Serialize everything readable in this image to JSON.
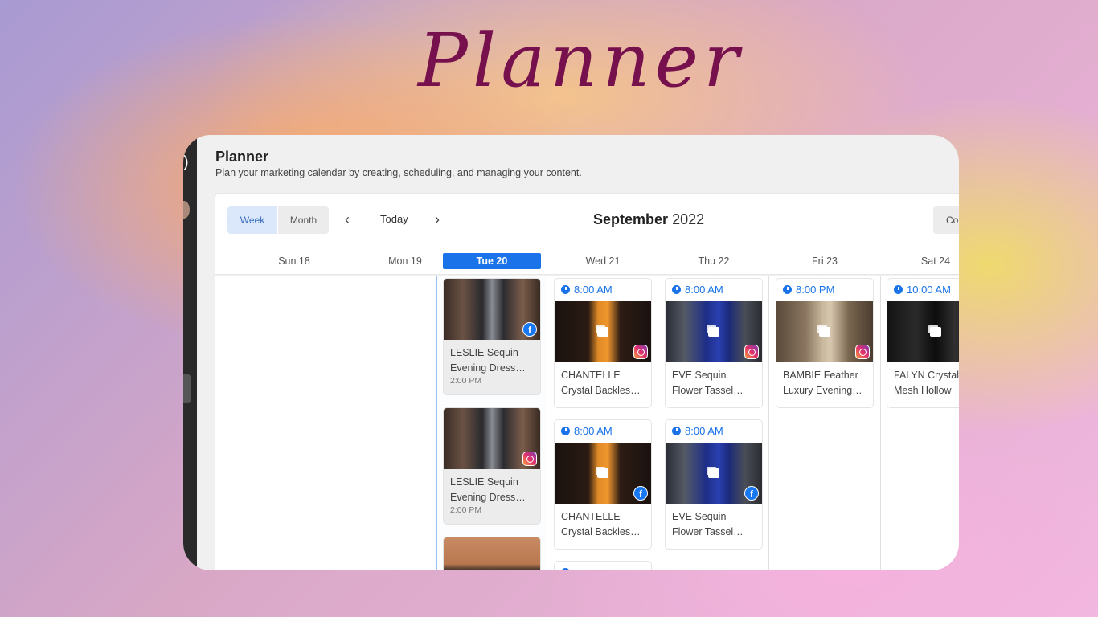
{
  "hero": {
    "title": "Planner"
  },
  "page": {
    "title": "Planner",
    "subtitle": "Plan your marketing calendar by creating, scheduling, and managing your content."
  },
  "toolbar": {
    "week_label": "Week",
    "month_label": "Month",
    "today_label": "Today",
    "month": "September",
    "year": "2022",
    "right_button_label": "Co"
  },
  "days": [
    {
      "label": "Sun 18",
      "today": false
    },
    {
      "label": "Mon 19",
      "today": false
    },
    {
      "label": "Tue 20",
      "today": true
    },
    {
      "label": "Wed 21",
      "today": false
    },
    {
      "label": "Thu 22",
      "today": false
    },
    {
      "label": "Fri 23",
      "today": false
    },
    {
      "label": "Sat 24",
      "today": false
    }
  ],
  "tuesday_posts": [
    {
      "line1": "LESLIE Sequin",
      "line2": "Evening Dress…",
      "time": "2:00 PM",
      "platform": "facebook"
    },
    {
      "line1": "LESLIE Sequin",
      "line2": "Evening Dress…",
      "time": "2:00 PM",
      "platform": "instagram"
    }
  ],
  "posts": {
    "wed_1": {
      "time": "8:00 AM",
      "line1": "CHANTELLE",
      "line2": "Crystal Backles…",
      "platform": "instagram"
    },
    "thu_1": {
      "time": "8:00 AM",
      "line1": "EVE Sequin",
      "line2": "Flower Tassel…",
      "platform": "instagram"
    },
    "fri_1": {
      "time": "8:00 PM",
      "line1": "BAMBIE Feather",
      "line2": "Luxury Evening…",
      "platform": "instagram"
    },
    "sat_1": {
      "time": "10:00 AM",
      "line1": "FALYN Crystal",
      "line2": "Mesh Hollow",
      "platform": "instagram"
    },
    "wed_2": {
      "time": "8:00 AM",
      "line1": "CHANTELLE",
      "line2": "Crystal Backles…",
      "platform": "facebook"
    },
    "thu_2": {
      "time": "8:00 AM",
      "line1": "EVE Sequin",
      "line2": "Flower Tassel…",
      "platform": "facebook"
    }
  },
  "icons": {
    "facebook_glyph": "f",
    "prev": "‹",
    "next": "›"
  },
  "colors": {
    "accent": "#1a73e8",
    "hero_title": "#76114e"
  }
}
